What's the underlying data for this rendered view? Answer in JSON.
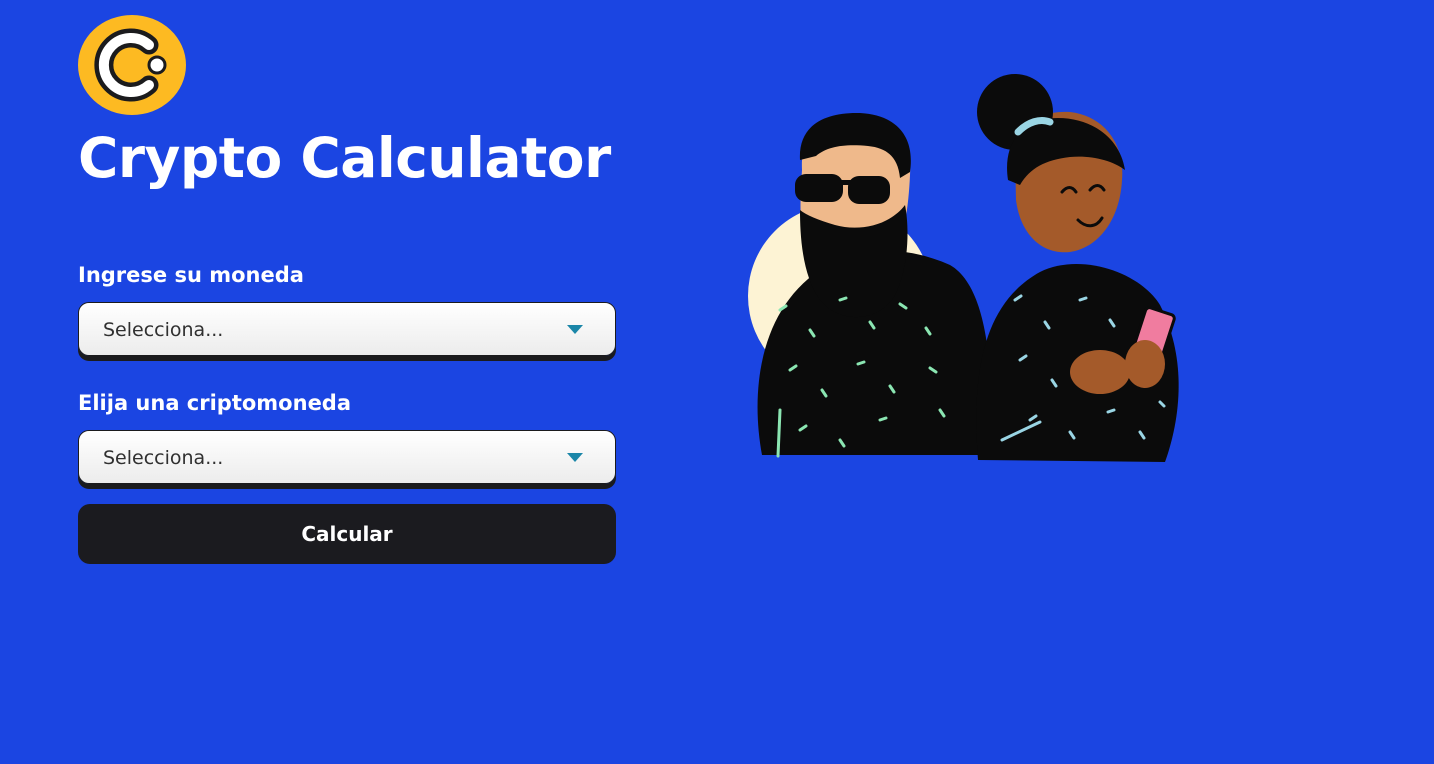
{
  "colors": {
    "background": "#1b45e2",
    "logo": "#fdba22",
    "button": "#1b1b1f",
    "caret": "#1b86a8"
  },
  "header": {
    "logo_icon": "crypto-coin-logo",
    "title": "Crypto Calculator"
  },
  "form": {
    "currency": {
      "label": "Ingrese su moneda",
      "selected": "Selecciona..."
    },
    "crypto": {
      "label": "Elija una criptomoneda",
      "selected": "Selecciona..."
    },
    "submit_label": "Calcular"
  },
  "illustration": {
    "icon": "people-illustration"
  }
}
